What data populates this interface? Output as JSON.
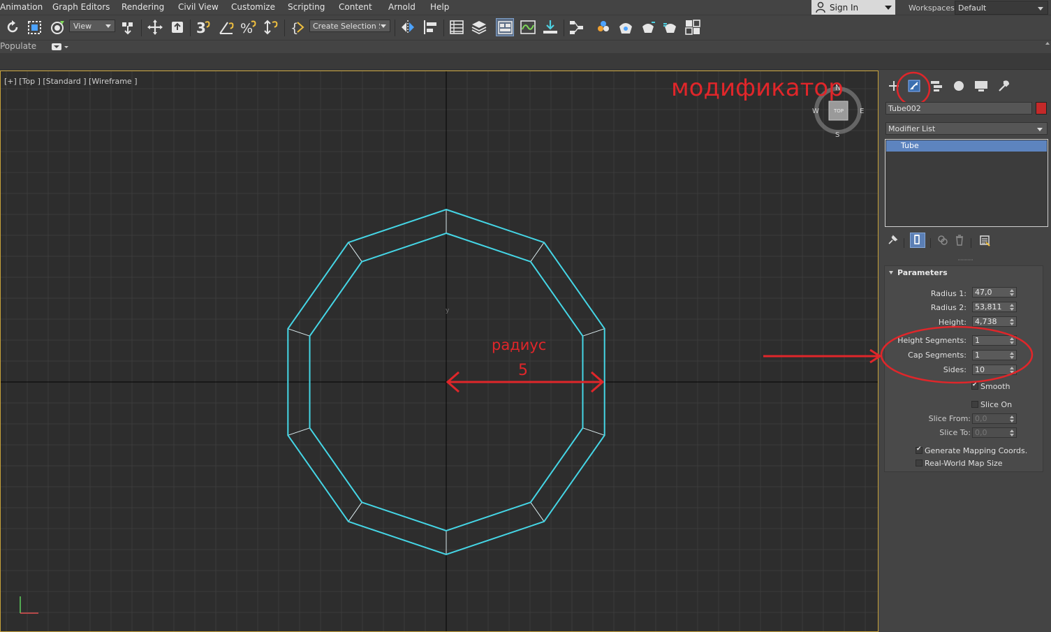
{
  "menu": {
    "items": [
      "Animation",
      "Graph Editors",
      "Rendering",
      "Civil View",
      "Customize",
      "Scripting",
      "Content",
      "Arnold",
      "Help"
    ],
    "sign_in": "Sign In",
    "workspaces_label": "Workspaces:",
    "workspace_value": "Default"
  },
  "toolbar": {
    "view_dropdown": "View",
    "selection_set_dropdown": "Create Selection Se",
    "icons": [
      "undo-icon",
      "select-region-icon",
      "paint-select-icon",
      "select-and-link-icon",
      "move-icon",
      "select-object-icon",
      "snap-3-icon",
      "angle-snap-icon",
      "percent-snap-icon",
      "spinner-snap-icon",
      "named-selection-icon",
      "mirror-icon",
      "align-icon",
      "scene-explorer-icon",
      "layer-explorer-icon",
      "ribbon-icon",
      "curve-editor-icon",
      "dope-sheet-icon",
      "schematic-icon",
      "material-editor-icon",
      "render-setup-icon",
      "render-frame-icon",
      "render-icon",
      "render-online-icon",
      "viewport-layout-icon"
    ]
  },
  "ribbon": {
    "label": "Populate"
  },
  "viewport": {
    "label": "[+] [Top ] [Standard ] [Wireframe ]",
    "wire_color": "#45d6e6",
    "sides": 10,
    "viewcube": {
      "top": "TOP",
      "north": "N",
      "south": "S",
      "west": "W",
      "east": "E"
    },
    "axis_y": "y"
  },
  "annotations": {
    "modifier_label": "модификатор",
    "radius_label": "радиус",
    "radius_value": "5",
    "color": "#e0262a"
  },
  "command_panel": {
    "object_name": "Tube002",
    "object_color": "#c42929",
    "modifier_list": "Modifier List",
    "stack": [
      "Tube"
    ],
    "rollout_title": "Parameters",
    "params": {
      "radius1_label": "Radius 1:",
      "radius1": "47,0",
      "radius2_label": "Radius 2:",
      "radius2": "53,811",
      "height_label": "Height:",
      "height": "4,738",
      "height_segments_label": "Height Segments:",
      "height_segments": "1",
      "cap_segments_label": "Cap Segments:",
      "cap_segments": "1",
      "sides_label": "Sides:",
      "sides": "10",
      "smooth_label": "Smooth",
      "slice_on_label": "Slice On",
      "slice_from_label": "Slice From:",
      "slice_from": "0,0",
      "slice_to_label": "Slice To:",
      "slice_to": "0,0",
      "gen_mapping_label": "Generate Mapping Coords.",
      "real_world_label": "Real-World Map Size"
    },
    "checks": {
      "smooth": true,
      "slice_on": false,
      "gen_mapping": true,
      "real_world": false
    }
  }
}
